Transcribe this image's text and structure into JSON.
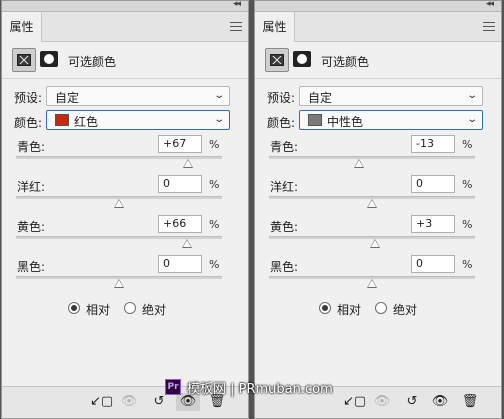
{
  "panels": [
    {
      "tab": "属性",
      "adjustment_title": "可选颜色",
      "preset_label": "预设:",
      "preset_value": "自定",
      "color_label": "颜色:",
      "color_value": "红色",
      "color_swatch": "#c8270e",
      "sliders": [
        {
          "label": "青色:",
          "value": "+67",
          "level": 0.67
        },
        {
          "label": "洋红:",
          "value": "0",
          "level": 0
        },
        {
          "label": "黄色:",
          "value": "+66",
          "level": 0.66
        },
        {
          "label": "黑色:",
          "value": "0",
          "level": 0
        }
      ],
      "percent": "%",
      "method_relative": "相对",
      "method_absolute": "绝对",
      "method_selected": "relative"
    },
    {
      "tab": "属性",
      "adjustment_title": "可选颜色",
      "preset_label": "预设:",
      "preset_value": "自定",
      "color_label": "颜色:",
      "color_value": "中性色",
      "color_swatch": "#7a7a7a",
      "sliders": [
        {
          "label": "青色:",
          "value": "-13",
          "level": -0.13
        },
        {
          "label": "洋红:",
          "value": "0",
          "level": 0
        },
        {
          "label": "黄色:",
          "value": "+3",
          "level": 0.03
        },
        {
          "label": "黑色:",
          "value": "0",
          "level": 0
        }
      ],
      "percent": "%",
      "method_relative": "相对",
      "method_absolute": "绝对",
      "method_selected": "relative"
    }
  ],
  "watermark": {
    "logo": "Pr",
    "text": "模板网 | PRmuban.com"
  }
}
